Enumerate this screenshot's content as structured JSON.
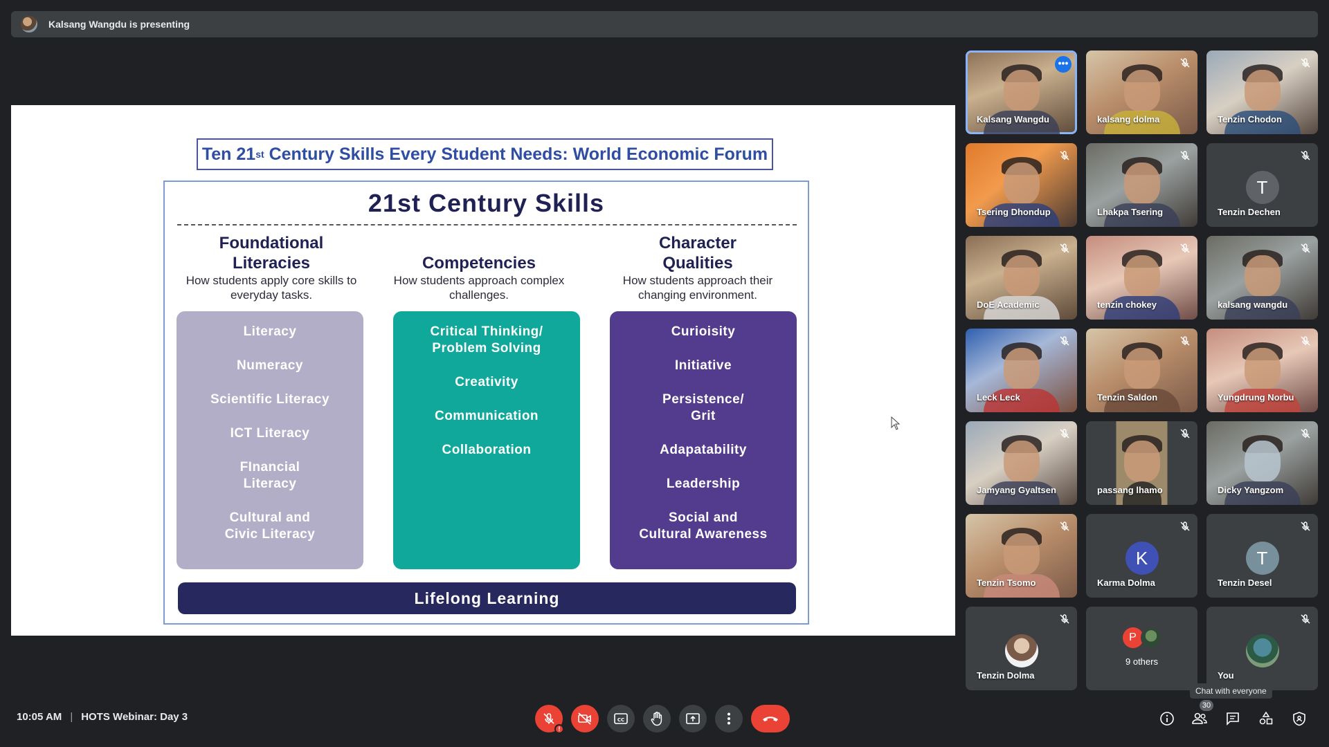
{
  "meeting": {
    "presenter_text": "Kalsang Wangdu is presenting",
    "time": "10:05 AM",
    "title": "HOTS Webinar: Day 3",
    "participant_count": "30",
    "tooltip": "Chat with everyone"
  },
  "slide": {
    "title_pre": "Ten 21",
    "title_sup": "st",
    "title_post": " Century Skills Every Student Needs: World Economic Forum",
    "heading": "21st Century Skills",
    "columns": [
      {
        "heading": "Foundational Literacies",
        "heading_line1": "Foundational",
        "heading_line2": "Literacies",
        "subtitle": "How students apply core skills to everyday tasks.",
        "items": [
          "Literacy",
          "Numeracy",
          "Scientific Literacy",
          "ICT Literacy",
          "FInancial\nLiteracy",
          "Cultural and\nCivic Literacy"
        ]
      },
      {
        "heading": "Competencies",
        "subtitle": "How students approach complex challenges.",
        "items": [
          "Critical Thinking/\nProblem Solving",
          "Creativity",
          "Communication",
          "Collaboration"
        ]
      },
      {
        "heading": "Character Qualities",
        "heading_line1": "Character",
        "heading_line2": "Qualities",
        "subtitle": "How students approach their changing environment.",
        "items": [
          "Curioisity",
          "Initiative",
          "Persistence/\nGrit",
          "Adapatability",
          "Leadership",
          "Social and\nCultural Awareness"
        ]
      }
    ],
    "footer": "Lifelong Learning",
    "colors": {
      "gray": "#b2aec8",
      "teal": "#0fa89a",
      "purple": "#533b8e",
      "navy": "#27285e"
    }
  },
  "participants": [
    "Kalsang Wangdu",
    "kalsang dolma",
    "Tenzin Chodon",
    "Tsering Dhondup",
    "Lhakpa Tsering",
    "Tenzin Dechen",
    "DoE Academic",
    "tenzin chokey",
    "kalsang wangdu",
    "Leck Leck",
    "Tenzin Saldon",
    "Yungdrung Norbu",
    "Jamyang Gyaltsen",
    "passang lhamo",
    "Dicky Yangzom",
    "Tenzin Tsomo",
    "Karma Dolma",
    "Tenzin Desel",
    "Tenzin Dolma",
    "9 others",
    "You"
  ],
  "avatar_letters": {
    "tenzin_dechen": "T",
    "karma_dolma": "K",
    "tenzin_desel": "T",
    "others_first": "P"
  },
  "icons": {
    "mic": "mic-off-icon",
    "cam": "cam-off-icon",
    "cc": "captions-icon",
    "hand": "raise-hand-icon",
    "present": "present-icon",
    "more": "more-vert-icon",
    "end": "end-call-icon",
    "info": "info-icon",
    "people": "people-icon",
    "chat": "chat-icon",
    "activities": "activities-icon",
    "security": "host-controls-icon"
  }
}
